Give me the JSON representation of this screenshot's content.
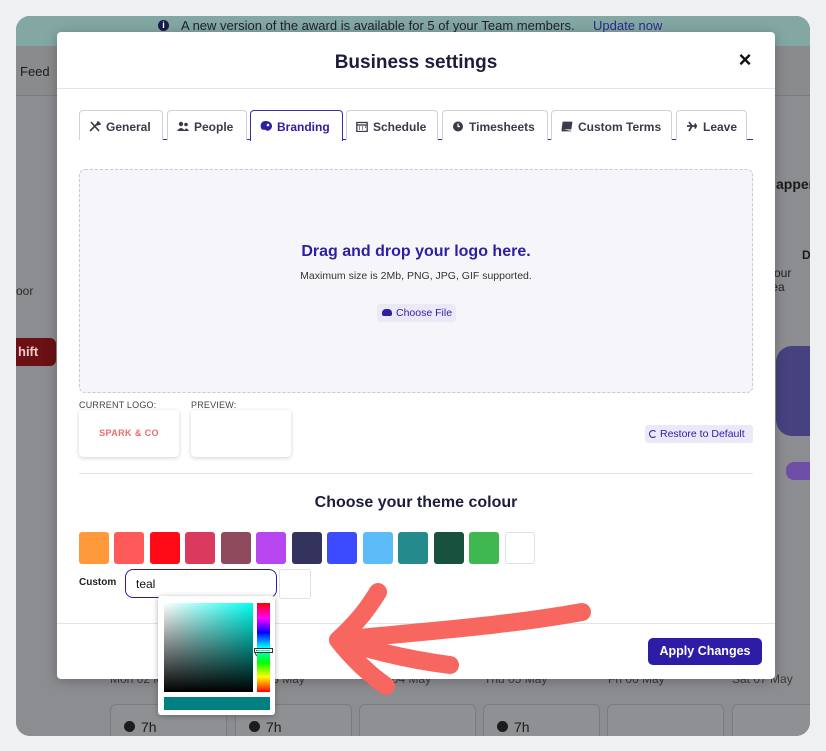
{
  "banner": {
    "message": "A new version of the award is available for 5 of your Team members.",
    "link": "Update now"
  },
  "background": {
    "feed": "Feed",
    "floor": "oor",
    "shift_button": "hift",
    "right_title": "appen",
    "right_d": "D",
    "right_team": "your tea",
    "days": [
      "Mon 02 May",
      "Tue 03 May",
      "Wed 04 May",
      "Thu 05 May",
      "Fri 06 May",
      "Sat 07 May"
    ],
    "hours": [
      "7h",
      "7h",
      "7h"
    ]
  },
  "modal": {
    "title": "Business settings",
    "close": "×",
    "tabs": [
      {
        "label": "General",
        "icon": "tools-icon"
      },
      {
        "label": "People",
        "icon": "people-icon"
      },
      {
        "label": "Branding",
        "icon": "palette-icon",
        "active": true
      },
      {
        "label": "Schedule",
        "icon": "calendar-icon"
      },
      {
        "label": "Timesheets",
        "icon": "clock-icon"
      },
      {
        "label": "Custom Terms",
        "icon": "book-icon"
      },
      {
        "label": "Leave",
        "icon": "plane-icon"
      }
    ],
    "dropzone": {
      "title": "Drag and drop your logo here.",
      "subtitle": "Maximum size is 2Mb, PNG, JPG, GIF supported.",
      "choose_file": "Choose File"
    },
    "logo": {
      "current_label": "CURRENT LOGO:",
      "preview_label": "PREVIEW:",
      "current_text": "SPARK & CO",
      "restore": "Restore to Default"
    },
    "theme": {
      "title": "Choose your theme colour",
      "swatches": [
        "#ff9a3c",
        "#ff5a5a",
        "#ff0a17",
        "#d93a5e",
        "#8e4a5c",
        "#b846f0",
        "#33335e",
        "#3c4bff",
        "#5cbcf7",
        "#248a8c",
        "#18513e",
        "#3fb852",
        "#ffffff"
      ],
      "custom_label": "Custom",
      "custom_value": "teal",
      "picked_colour": "#008080"
    },
    "apply": "Apply Changes"
  }
}
